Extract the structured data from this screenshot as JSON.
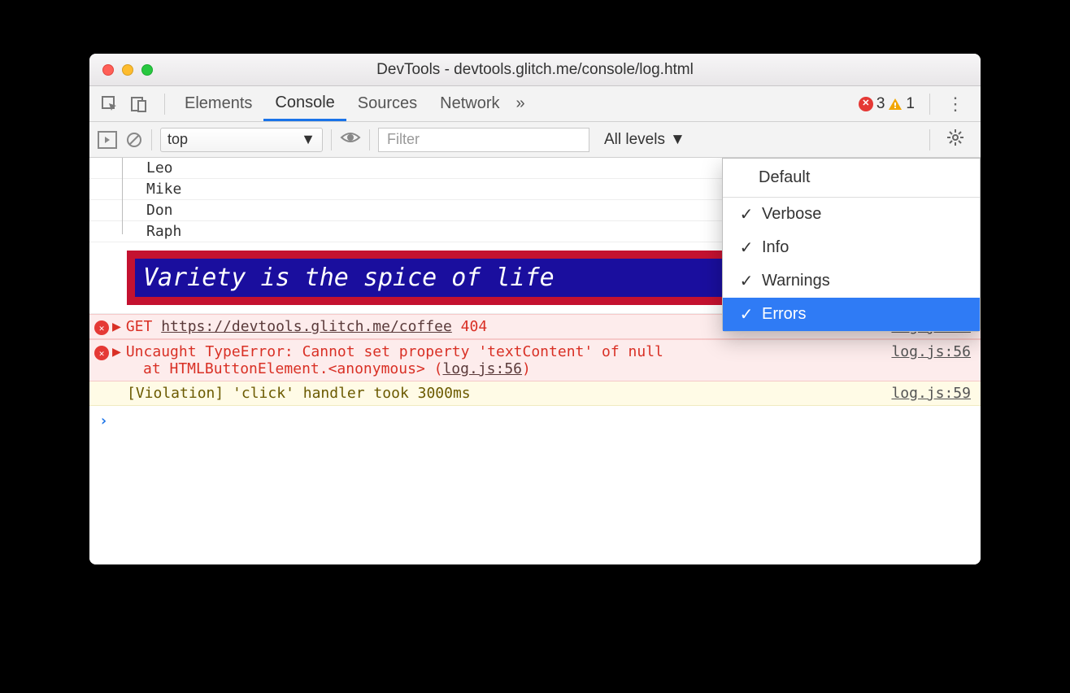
{
  "window": {
    "title": "DevTools - devtools.glitch.me/console/log.html"
  },
  "tabs": {
    "items": [
      "Elements",
      "Console",
      "Sources",
      "Network"
    ],
    "active": "Console",
    "overflow_glyph": "»",
    "error_count": "3",
    "warning_count": "1"
  },
  "toolbar": {
    "context": "top",
    "filter_placeholder": "Filter",
    "levels_label": "All levels"
  },
  "levels_menu": {
    "default_label": "Default",
    "options": [
      {
        "label": "Verbose",
        "checked": true,
        "selected": false
      },
      {
        "label": "Info",
        "checked": true,
        "selected": false
      },
      {
        "label": "Warnings",
        "checked": true,
        "selected": false
      },
      {
        "label": "Errors",
        "checked": true,
        "selected": true
      }
    ]
  },
  "console": {
    "names": [
      "Leo",
      "Mike",
      "Don",
      "Raph"
    ],
    "styled_message": "Variety is the spice of life",
    "errors": [
      {
        "prefix": "GET",
        "url": "https://devtools.glitch.me/coffee",
        "status": "404",
        "src": "log.js:68"
      },
      {
        "message": "Uncaught TypeError: Cannot set property 'textContent' of null",
        "stack_prefix": "at HTMLButtonElement.<anonymous> (",
        "stack_link": "log.js:56",
        "stack_suffix": ")",
        "src": "log.js:56"
      }
    ],
    "violation": {
      "message": "[Violation] 'click' handler took 3000ms",
      "src": "log.js:59"
    },
    "prompt_glyph": "›"
  }
}
